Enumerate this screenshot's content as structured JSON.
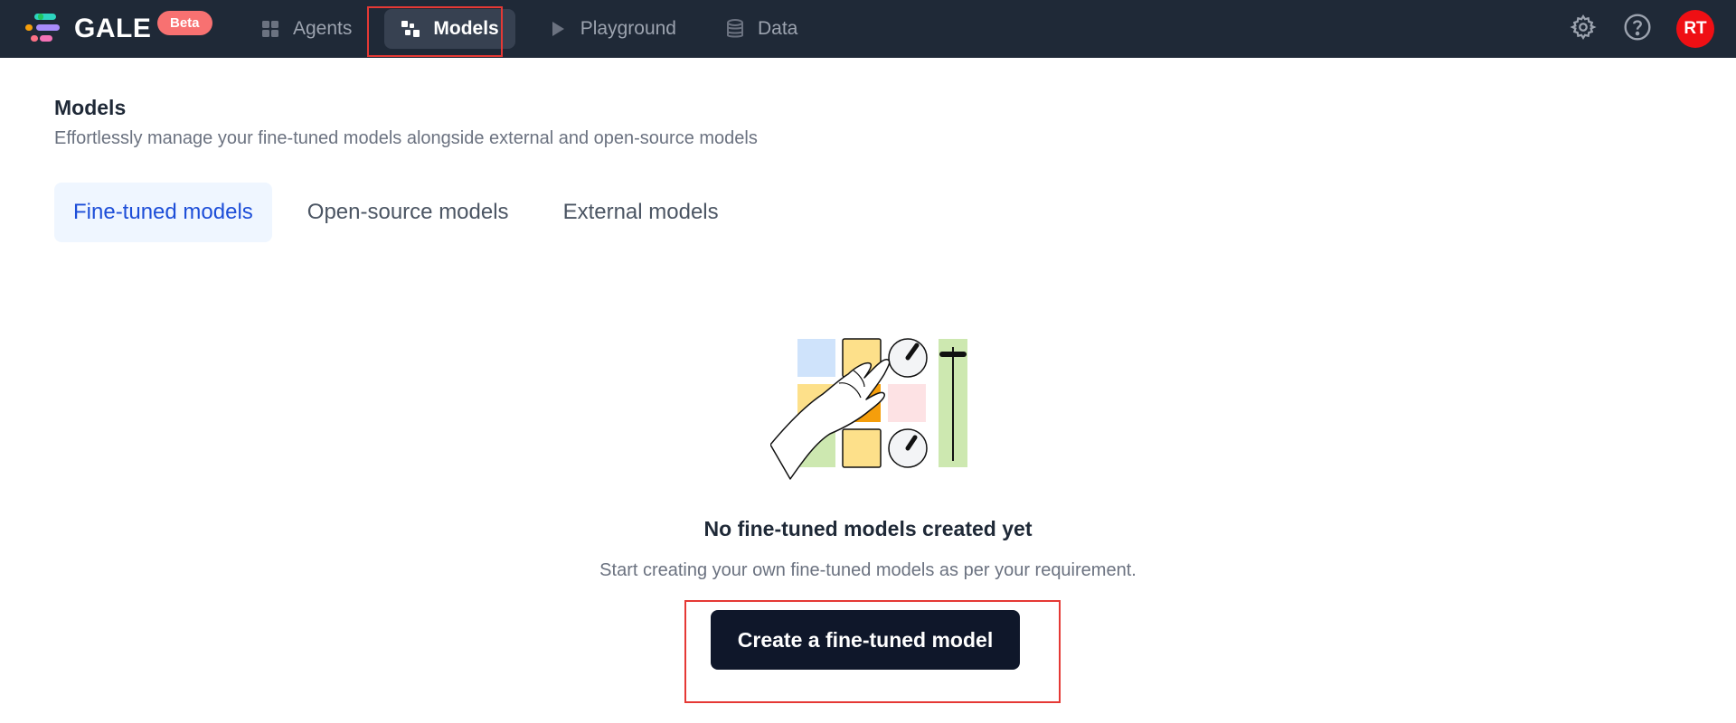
{
  "app": {
    "brand": "GALE",
    "badge": "Beta",
    "colors": {
      "topbar": "#1f2937",
      "accent": "#1d4ed8",
      "avatar": "#ef0f14",
      "badge": "#f87171",
      "highlight": "#e53935"
    }
  },
  "nav": {
    "items": [
      {
        "label": "Agents",
        "icon": "grid-icon",
        "active": false
      },
      {
        "label": "Models",
        "icon": "models-icon",
        "active": true
      },
      {
        "label": "Playground",
        "icon": "play-icon",
        "active": false
      },
      {
        "label": "Data",
        "icon": "database-icon",
        "active": false
      }
    ]
  },
  "header_right": {
    "settings_icon": "gear-icon",
    "help_icon": "help-circle-icon",
    "avatar_initials": "RT"
  },
  "page": {
    "title": "Models",
    "subtitle": "Effortlessly manage your fine-tuned models alongside external and open-source models"
  },
  "tabs": [
    {
      "label": "Fine-tuned models",
      "active": true
    },
    {
      "label": "Open-source models",
      "active": false
    },
    {
      "label": "External models",
      "active": false
    }
  ],
  "empty_state": {
    "illustration": "control-panel-hand-illustration",
    "title": "No fine-tuned models created yet",
    "subtitle": "Start creating your own fine-tuned models as per your requirement.",
    "button_label": "Create a fine-tuned model"
  }
}
